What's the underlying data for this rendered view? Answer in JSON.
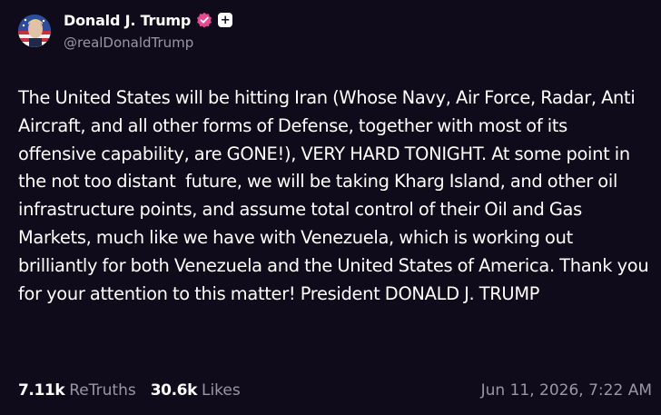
{
  "post": {
    "author": {
      "display_name": "Donald J. Trump",
      "handle": "@realDonaldTrump",
      "avatar_icon": "avatar-flag-portrait",
      "verified_icon": "verified-badge-icon",
      "verified_color": "#e64a8e",
      "plus_badge": "+"
    },
    "text": "The United States will be hitting Iran (Whose Navy, Air Force, Radar, Anti Aircraft, and all other forms of Defense, together with most of its offensive capability, are GONE!), VERY HARD TONIGHT. At some point in the not too distant  future, we will be taking Kharg Island, and other oil infrastructure points, and assume total control of their Oil and Gas Markets, much like we have with Venezuela, which is working out brilliantly for both Venezuela and the United States of America. Thank you for your attention to this matter! President DONALD J. TRUMP",
    "stats": {
      "retruths_count": "7.11k",
      "retruths_label": "ReTruths",
      "likes_count": "30.6k",
      "likes_label": "Likes"
    },
    "timestamp": "Jun 11, 2026, 7:22 AM"
  },
  "colors": {
    "background": "#0f0b1a",
    "text": "#ffffff",
    "muted": "#9a96a6"
  }
}
